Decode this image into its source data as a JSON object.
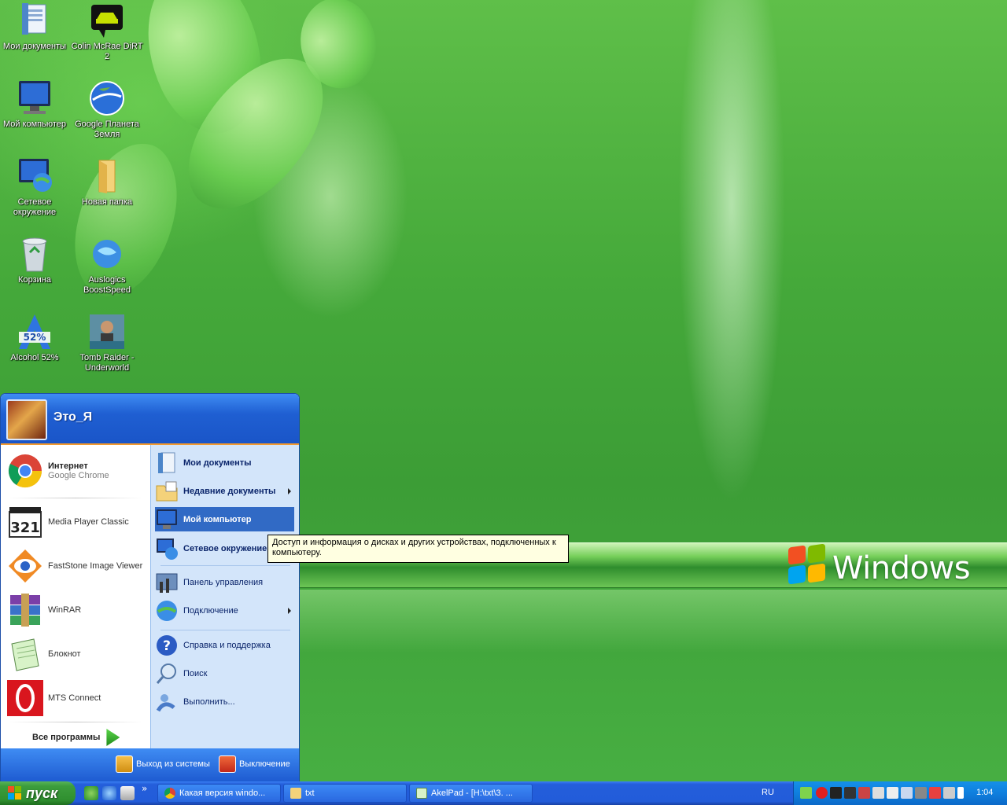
{
  "wallpaper": {
    "brand_text": "Windows"
  },
  "desktop_icons": [
    {
      "label": "Мои документы",
      "icon": "my-documents-icon"
    },
    {
      "label": "Colin McRae DiRT 2",
      "icon": "dirt2-game-icon"
    },
    {
      "label": "Мой компьютер",
      "icon": "my-computer-icon"
    },
    {
      "label": "Google Планета Земля",
      "icon": "google-earth-icon"
    },
    {
      "label": "Сетевое окружение",
      "icon": "network-places-icon"
    },
    {
      "label": "Новая папка",
      "icon": "folder-icon"
    },
    {
      "label": "Корзина",
      "icon": "recycle-bin-icon"
    },
    {
      "label": "Auslogics BoostSpeed",
      "icon": "boostspeed-icon"
    },
    {
      "label": "Alcohol 52%",
      "icon": "alcohol-icon"
    },
    {
      "label": "Tomb Raider - Underworld",
      "icon": "tomb-raider-icon"
    }
  ],
  "start_menu": {
    "user_name": "Это_Я",
    "pinned": [
      {
        "title": "Интернет",
        "subtitle": "Google Chrome",
        "icon": "chrome-icon"
      },
      {
        "title": "Media Player Classic",
        "icon": "media-player-classic-icon"
      },
      {
        "title": "FastStone Image Viewer",
        "icon": "faststone-icon"
      },
      {
        "title": "WinRAR",
        "icon": "winrar-icon"
      },
      {
        "title": "Блокнот",
        "icon": "notepad-icon"
      },
      {
        "title": "MTS Connect",
        "icon": "mts-connect-icon"
      }
    ],
    "all_programs": "Все программы",
    "right_items": [
      {
        "label": "Мои документы",
        "icon": "my-documents-icon"
      },
      {
        "label": "Недавние документы",
        "icon": "recent-documents-icon"
      },
      {
        "label": "Мой компьютер",
        "icon": "my-computer-icon"
      },
      {
        "label": "Сетевое окружение",
        "icon": "network-places-icon"
      },
      {
        "label": "Панель управления",
        "icon": "control-panel-icon"
      },
      {
        "label": "Подключение",
        "icon": "connect-icon"
      },
      {
        "label": "Справка и поддержка",
        "icon": "help-icon"
      },
      {
        "label": "Поиск",
        "icon": "search-icon"
      },
      {
        "label": "Выполнить...",
        "icon": "run-icon"
      }
    ],
    "logoff": "Выход из системы",
    "shutdown": "Выключение",
    "tooltip": "Доступ и информация о дисках и других устройствах, подключенных к компьютеру."
  },
  "taskbar": {
    "start_label": "пуск",
    "quick_launch_more": "»",
    "tasks": [
      {
        "label": "Какая версия windo...",
        "icon": "chrome-icon"
      },
      {
        "label": "txt",
        "icon": "folder-icon"
      },
      {
        "label": "AkelPad - [H:\\txt\\3. ...",
        "icon": "akelpad-icon"
      }
    ],
    "language": "RU",
    "clock": "1:04"
  },
  "colors": {
    "taskbar_blue": "#245edb",
    "start_green": "#3c9d3c",
    "selection_blue": "#316ac5",
    "tooltip_bg": "#ffffe1"
  }
}
